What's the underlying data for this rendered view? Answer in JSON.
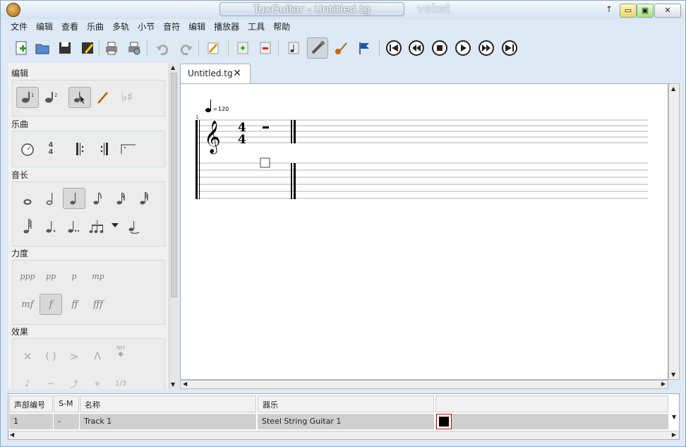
{
  "window": {
    "title": "TuxGuitar - Untitled.tg",
    "extra": "veket"
  },
  "menu": [
    "文件",
    "编辑",
    "查看",
    "乐曲",
    "多轨",
    "小节",
    "音符",
    "编辑",
    "播放器",
    "工具",
    "帮助"
  ],
  "left_panel": {
    "sections": [
      "编辑",
      "乐曲",
      "音长",
      "力度",
      "效果"
    ],
    "dynamics": [
      "ppp",
      "pp",
      "p",
      "mp",
      "mf",
      "f",
      "ff",
      "fff"
    ],
    "effects_nh": "NH",
    "effects_triplet": "1/3",
    "time_sig_top": "4",
    "time_sig_bottom": "4",
    "triplet_num": "3",
    "voice_1": "1",
    "voice_2": "2"
  },
  "tab": {
    "label": "Untitled.tg"
  },
  "score": {
    "tempo": "120",
    "measure_number": "1",
    "time_top": "4",
    "time_bottom": "4"
  },
  "tracks": {
    "headers": [
      "声部编号",
      "S-M",
      "名称",
      "器乐",
      ""
    ],
    "rows": [
      {
        "number": "1",
        "sm": "-",
        "name": "Track 1",
        "instrument": "Steel String Guitar 1",
        "color": "#000000"
      }
    ]
  },
  "colors": {
    "accent": "#1a5aa8",
    "selected": "#d8d8d8"
  }
}
